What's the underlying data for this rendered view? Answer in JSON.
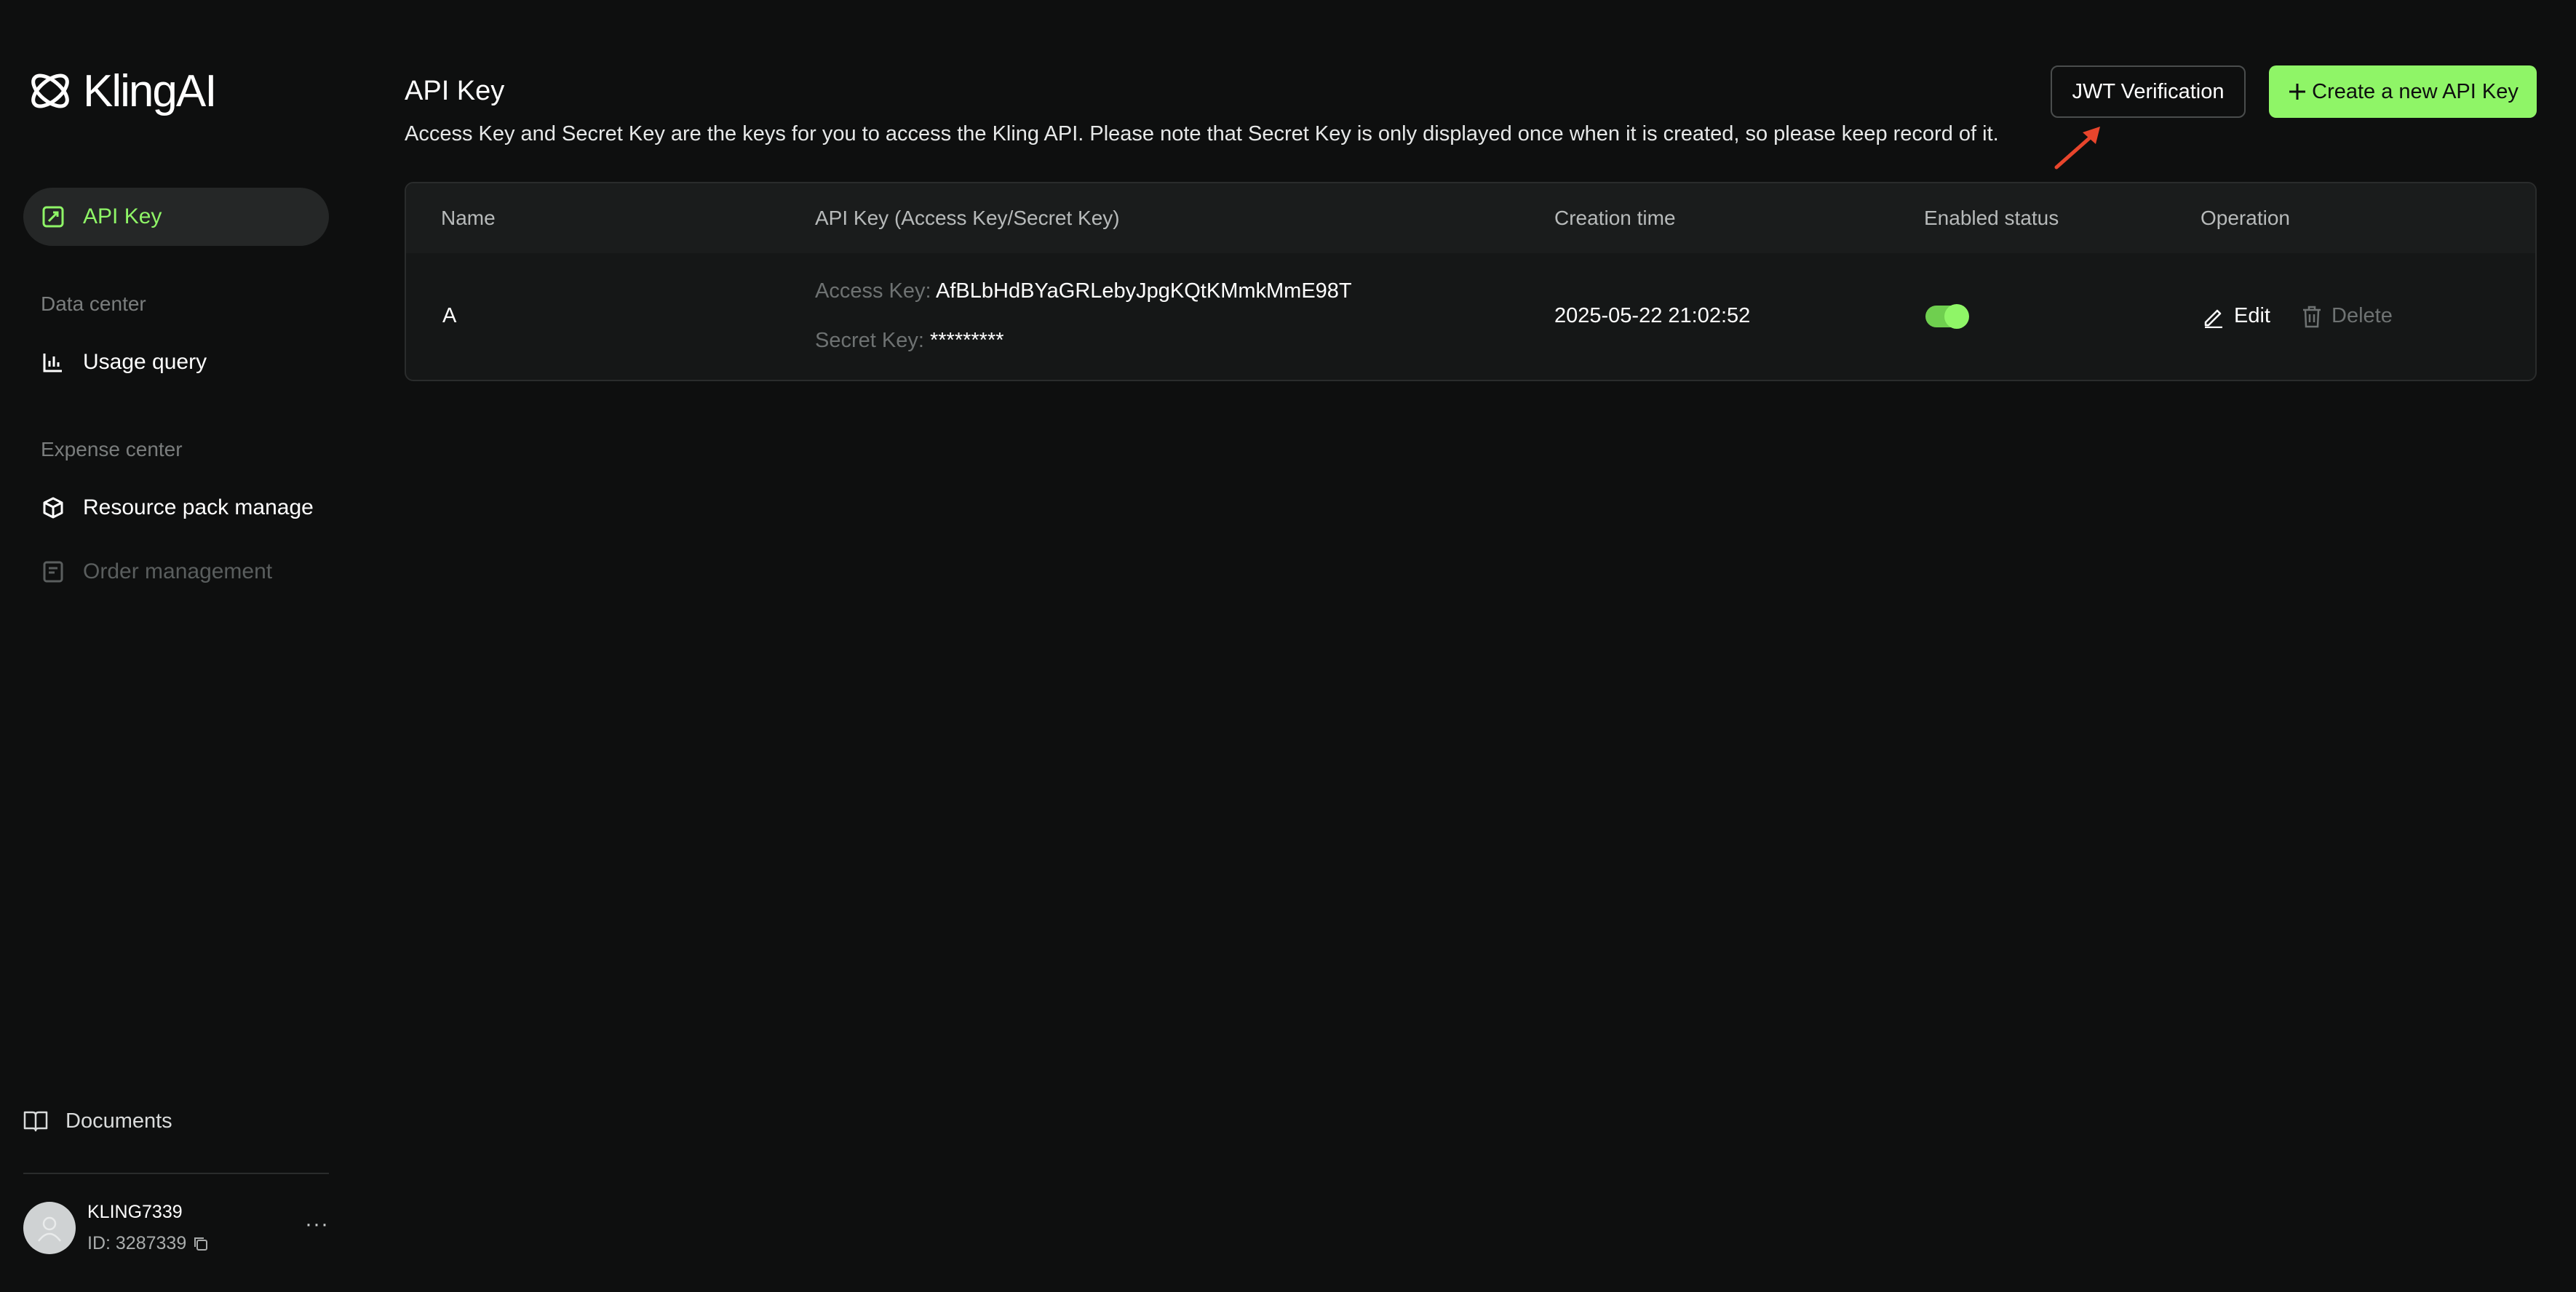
{
  "brand": {
    "name": "KlingAI"
  },
  "sidebar": {
    "items": [
      {
        "label": "API Key",
        "active": true
      },
      {
        "section": "Data center"
      },
      {
        "label": "Usage query"
      },
      {
        "section": "Expense center"
      },
      {
        "label": "Resource pack manage"
      },
      {
        "label": "Order management",
        "disabled": true
      }
    ],
    "data_center_label": "Data center",
    "expense_center_label": "Expense center",
    "api_key_label": "API Key",
    "usage_query_label": "Usage query",
    "resource_pack_label": "Resource pack manage",
    "order_management_label": "Order management",
    "documents_label": "Documents"
  },
  "user": {
    "name": "KLING7339",
    "id_text": "ID: 3287339",
    "more_label": "···"
  },
  "header": {
    "title": "API Key",
    "description": "Access Key and Secret Key are the keys for you to access the Kling API. Please note that Secret Key is only displayed once when it is created, so please keep record of it.",
    "jwt_button": "JWT Verification",
    "create_button": "Create a new API Key"
  },
  "table": {
    "columns": [
      "Name",
      "API Key (Access Key/Secret Key)",
      "Creation time",
      "Enabled status",
      "Operation"
    ],
    "rows": [
      {
        "name": "A",
        "access_key_label": "Access Key:",
        "access_key": "AfBLbHdBYaGRLebyJpgKQtKMmkMmE98T",
        "secret_key_label": "Secret Key:",
        "secret_key": "*********",
        "creation_time": "2025-05-22 21:02:52",
        "enabled": true,
        "edit_label": "Edit",
        "delete_label": "Delete"
      }
    ]
  },
  "colors": {
    "accent": "#8ff567",
    "background": "#0e0f0f",
    "annotation_arrow": "#e8452c"
  }
}
